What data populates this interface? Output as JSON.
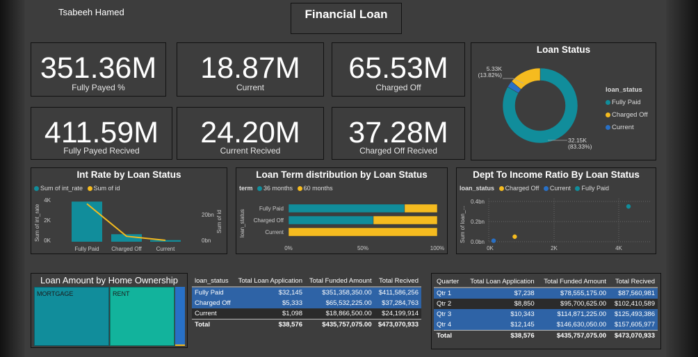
{
  "colors": {
    "teal": "#118d9b",
    "yellow": "#f5bb1f",
    "blue": "#2870c6",
    "tealLight": "#13b3a1"
  },
  "header": {
    "author": "Tsabeeh Hamed",
    "title": "Financial Loan"
  },
  "kpis": [
    {
      "value": "351.36M",
      "label": "Fully Payed %"
    },
    {
      "value": "18.87M",
      "label": "Current"
    },
    {
      "value": "65.53M",
      "label": "Charged Off"
    },
    {
      "value": "411.59M",
      "label": "Fully Payed Recived"
    },
    {
      "value": "24.20M",
      "label": "Current Recived"
    },
    {
      "value": "37.28M",
      "label": "Charged Off Recived"
    }
  ],
  "loan_status": {
    "title": "Loan Status",
    "legend_title": "loan_status",
    "legend": [
      "Fully Paid",
      "Charged Off",
      "Current"
    ],
    "label_small_value": "5.33K",
    "label_small_pct": "(13.82%)",
    "label_large_value": "32.15K",
    "label_large_pct": "(83.33%)"
  },
  "int_rate": {
    "title": "Int Rate by Loan Status",
    "legend": [
      "Sum of int_rate",
      "Sum of id"
    ],
    "y_label": "Sum of int_rate",
    "y2_label": "Sum of id",
    "y_ticks": [
      "4K",
      "2K",
      "0K"
    ],
    "y2_ticks": [
      "20bn",
      "0bn"
    ],
    "categories": [
      "Fully Paid",
      "Charged Off",
      "Current"
    ]
  },
  "loan_term": {
    "title": "Loan Term distribution by Loan Status",
    "legend_title": "term",
    "legend": [
      "36 months",
      "60 months"
    ],
    "y_label": "loan_status",
    "categories": [
      "Fully Paid",
      "Charged Off",
      "Current"
    ],
    "x_ticks": [
      "0%",
      "50%",
      "100%"
    ]
  },
  "dti": {
    "title": "Dept To Income Ratio By Loan Status",
    "legend_title": "loan_status",
    "legend": [
      "Charged Off",
      "Current",
      "Fully Paid"
    ],
    "y_label": "Sum of loan_...",
    "y_ticks": [
      "0.4bn",
      "0.2bn",
      "0.0bn"
    ],
    "x_ticks": [
      "0K",
      "2K",
      "4K"
    ]
  },
  "home_ownership": {
    "title": "Loan Amount by Home Ownership",
    "tiles": [
      "MORTGAGE",
      "RENT"
    ]
  },
  "status_table": {
    "headers": [
      "loan_status",
      "Total Loan Application",
      "Total Funded Amount",
      "Total Recived"
    ],
    "rows": [
      [
        "Fully Paid",
        "$32,145",
        "$351,358,350.00",
        "$411,586,256"
      ],
      [
        "Charged Off",
        "$5,333",
        "$65,532,225.00",
        "$37,284,763"
      ],
      [
        "Current",
        "$1,098",
        "$18,866,500.00",
        "$24,199,914"
      ]
    ],
    "total": [
      "Total",
      "$38,576",
      "$435,757,075.00",
      "$473,070,933"
    ]
  },
  "quarter_table": {
    "headers": [
      "Quarter",
      "Total Loan Application",
      "Total Funded Amount",
      "Total Recived"
    ],
    "rows": [
      [
        "Qtr 1",
        "$7,238",
        "$78,555,175.00",
        "$87,560,981"
      ],
      [
        "Qtr 2",
        "$8,850",
        "$95,700,625.00",
        "$102,410,589"
      ],
      [
        "Qtr 3",
        "$10,343",
        "$114,871,225.00",
        "$125,493,386"
      ],
      [
        "Qtr 4",
        "$12,145",
        "$146,630,050.00",
        "$157,605,977"
      ]
    ],
    "total": [
      "Total",
      "$38,576",
      "$435,757,075.00",
      "$473,070,933"
    ]
  },
  "chart_data": [
    {
      "type": "pie",
      "title": "Loan Status",
      "categories": [
        "Fully Paid",
        "Charged Off",
        "Current"
      ],
      "values": [
        32145,
        5333,
        1098
      ],
      "data_labels": [
        "32.15K (83.33%)",
        "5.33K (13.82%)",
        ""
      ]
    },
    {
      "type": "bar",
      "title": "Int Rate by Loan Status",
      "categories": [
        "Fully Paid",
        "Charged Off",
        "Current"
      ],
      "series": [
        {
          "name": "Sum of int_rate",
          "values": [
            3850,
            720,
            150
          ],
          "kind": "bar",
          "axis": "left"
        },
        {
          "name": "Sum of id",
          "values": [
            28,
            4,
            1
          ],
          "kind": "line",
          "axis": "right"
        }
      ],
      "ylim": [
        0,
        4500
      ],
      "y2lim": [
        0,
        40
      ]
    },
    {
      "type": "bar",
      "title": "Loan Term distribution by Loan Status",
      "orientation": "horizontal",
      "stacked": true,
      "categories": [
        "Fully Paid",
        "Charged Off",
        "Current"
      ],
      "series": [
        {
          "name": "36 months",
          "values": [
            78,
            57,
            0
          ]
        },
        {
          "name": "60 months",
          "values": [
            22,
            43,
            100
          ]
        }
      ],
      "xlim": [
        0,
        100
      ]
    },
    {
      "type": "scatter",
      "title": "Dept To Income Ratio By Loan Status",
      "series": [
        {
          "name": "Charged Off",
          "points": [
            [
              800,
              0.05
            ]
          ]
        },
        {
          "name": "Current",
          "points": [
            [
              150,
              0.01
            ]
          ]
        },
        {
          "name": "Fully Paid",
          "points": [
            [
              4300,
              0.35
            ]
          ]
        }
      ],
      "xlim": [
        0,
        5000
      ],
      "ylim": [
        0,
        0.45
      ]
    }
  ]
}
